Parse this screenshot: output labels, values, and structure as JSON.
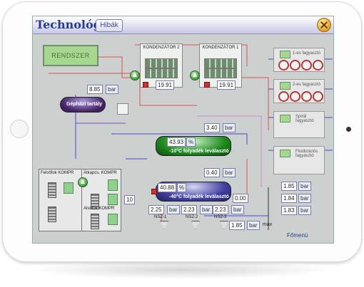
{
  "app": {
    "title": "Technológia",
    "tab_label": "Hibák",
    "footer": "Főmenü"
  },
  "system_status": "RENDSZER",
  "condensers": [
    {
      "name": "KONDENZÁTOR 2",
      "value": "19.91"
    },
    {
      "name": "KONDENZÁTOR 1",
      "value": "19.91"
    }
  ],
  "pressure_top": {
    "value": "8.85",
    "unit": "bar"
  },
  "oil_tank": {
    "label": "Gépházi tartály"
  },
  "tank_10": {
    "value": "43.93",
    "unit": "%",
    "label": "-10°C folyadék leválasztó"
  },
  "tank_40": {
    "value": "40.88",
    "unit": "%",
    "label": "-40°C folyadék leválasztó"
  },
  "pressure_3": {
    "value": "3.40",
    "unit": "bar"
  },
  "pressure_04": {
    "value": "0.40",
    "unit": "bar"
  },
  "pressure_000": {
    "value": "0.00",
    "unit": ""
  },
  "compressors": {
    "upper": "Felsőfok KOMPR",
    "alt": "Átkapcs. KOMPR",
    "lower": "Alsófok KOMPR"
  },
  "counter": {
    "value": "10"
  },
  "bottom_pressures": [
    {
      "value": "2.25",
      "unit": "bar"
    },
    {
      "value": "2.23",
      "unit": "bar"
    },
    {
      "value": "2.23",
      "unit": "bar"
    }
  ],
  "pump_labels": [
    "NSZ-1",
    "NSZ-2",
    "NSZ-3"
  ],
  "max_line": {
    "value": "1.85",
    "unit": "bar",
    "label": "max"
  },
  "freezers": [
    {
      "name": "1-es fagyasztó"
    },
    {
      "name": "2-es fagyasztó"
    },
    {
      "name": "Spirál fagyasztó"
    },
    {
      "name": "Fluidizációs fagyasztó"
    }
  ],
  "right_pressures": [
    {
      "value": "1.85",
      "unit": "bar"
    },
    {
      "value": "1.84",
      "unit": "bar"
    },
    {
      "value": "1.83",
      "unit": "bar"
    }
  ],
  "colors": {
    "accent": "#283c8c",
    "lcd": "#a5d88d",
    "tank_green": "#1f8a1f",
    "tank_blue": "#4040a0",
    "pipe_red": "#e05050",
    "pipe_blue": "#4a4ad0"
  }
}
